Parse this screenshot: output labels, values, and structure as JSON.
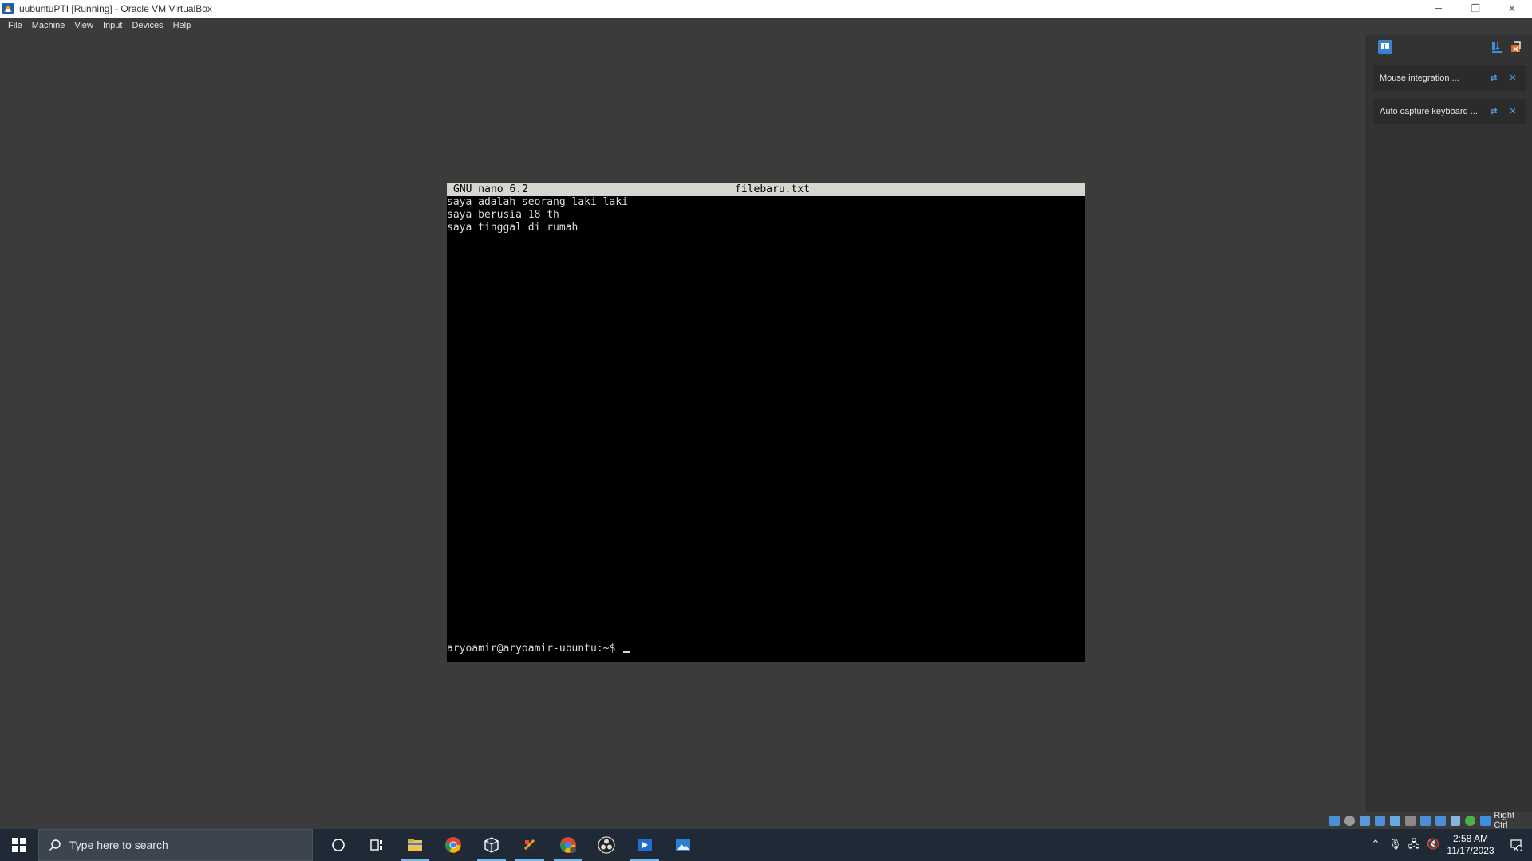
{
  "window": {
    "title": "uubuntuPTI [Running] - Oracle VM VirtualBox",
    "minimize_glyph": "─",
    "restore_glyph": "❐",
    "close_glyph": "✕"
  },
  "menu": [
    "File",
    "Machine",
    "View",
    "Input",
    "Devices",
    "Help"
  ],
  "terminal": {
    "nano_version": "GNU nano 6.2",
    "filename": "filebaru.txt",
    "lines": [
      "saya adalah seorang laki laki",
      "saya berusia 18 th",
      "saya tinggal di rumah"
    ],
    "prompt": "aryoamir@aryoamir-ubuntu:~$ "
  },
  "notifications": [
    {
      "message": "Mouse integration ...",
      "info_icon": "info-icon",
      "close_icon": "close-icon"
    },
    {
      "message": "Auto capture keyboard ...",
      "info_icon": "info-icon",
      "close_icon": "close-icon"
    }
  ],
  "statusbar": {
    "host_key": "Right Ctrl"
  },
  "taskbar": {
    "search_placeholder": "Type here to search",
    "apps": [
      "file-explorer-icon",
      "chrome-icon",
      "virtualbox-icon",
      "app-icon",
      "chrome-profile-icon",
      "obs-icon",
      "media-player-icon",
      "photos-icon"
    ]
  },
  "clock": {
    "time": "2:58 AM",
    "date": "11/17/2023"
  },
  "colors": {
    "accent": "#76b9ed",
    "vm_background": "#3b3b3b",
    "nano_header_bg": "#d3d7cf"
  }
}
